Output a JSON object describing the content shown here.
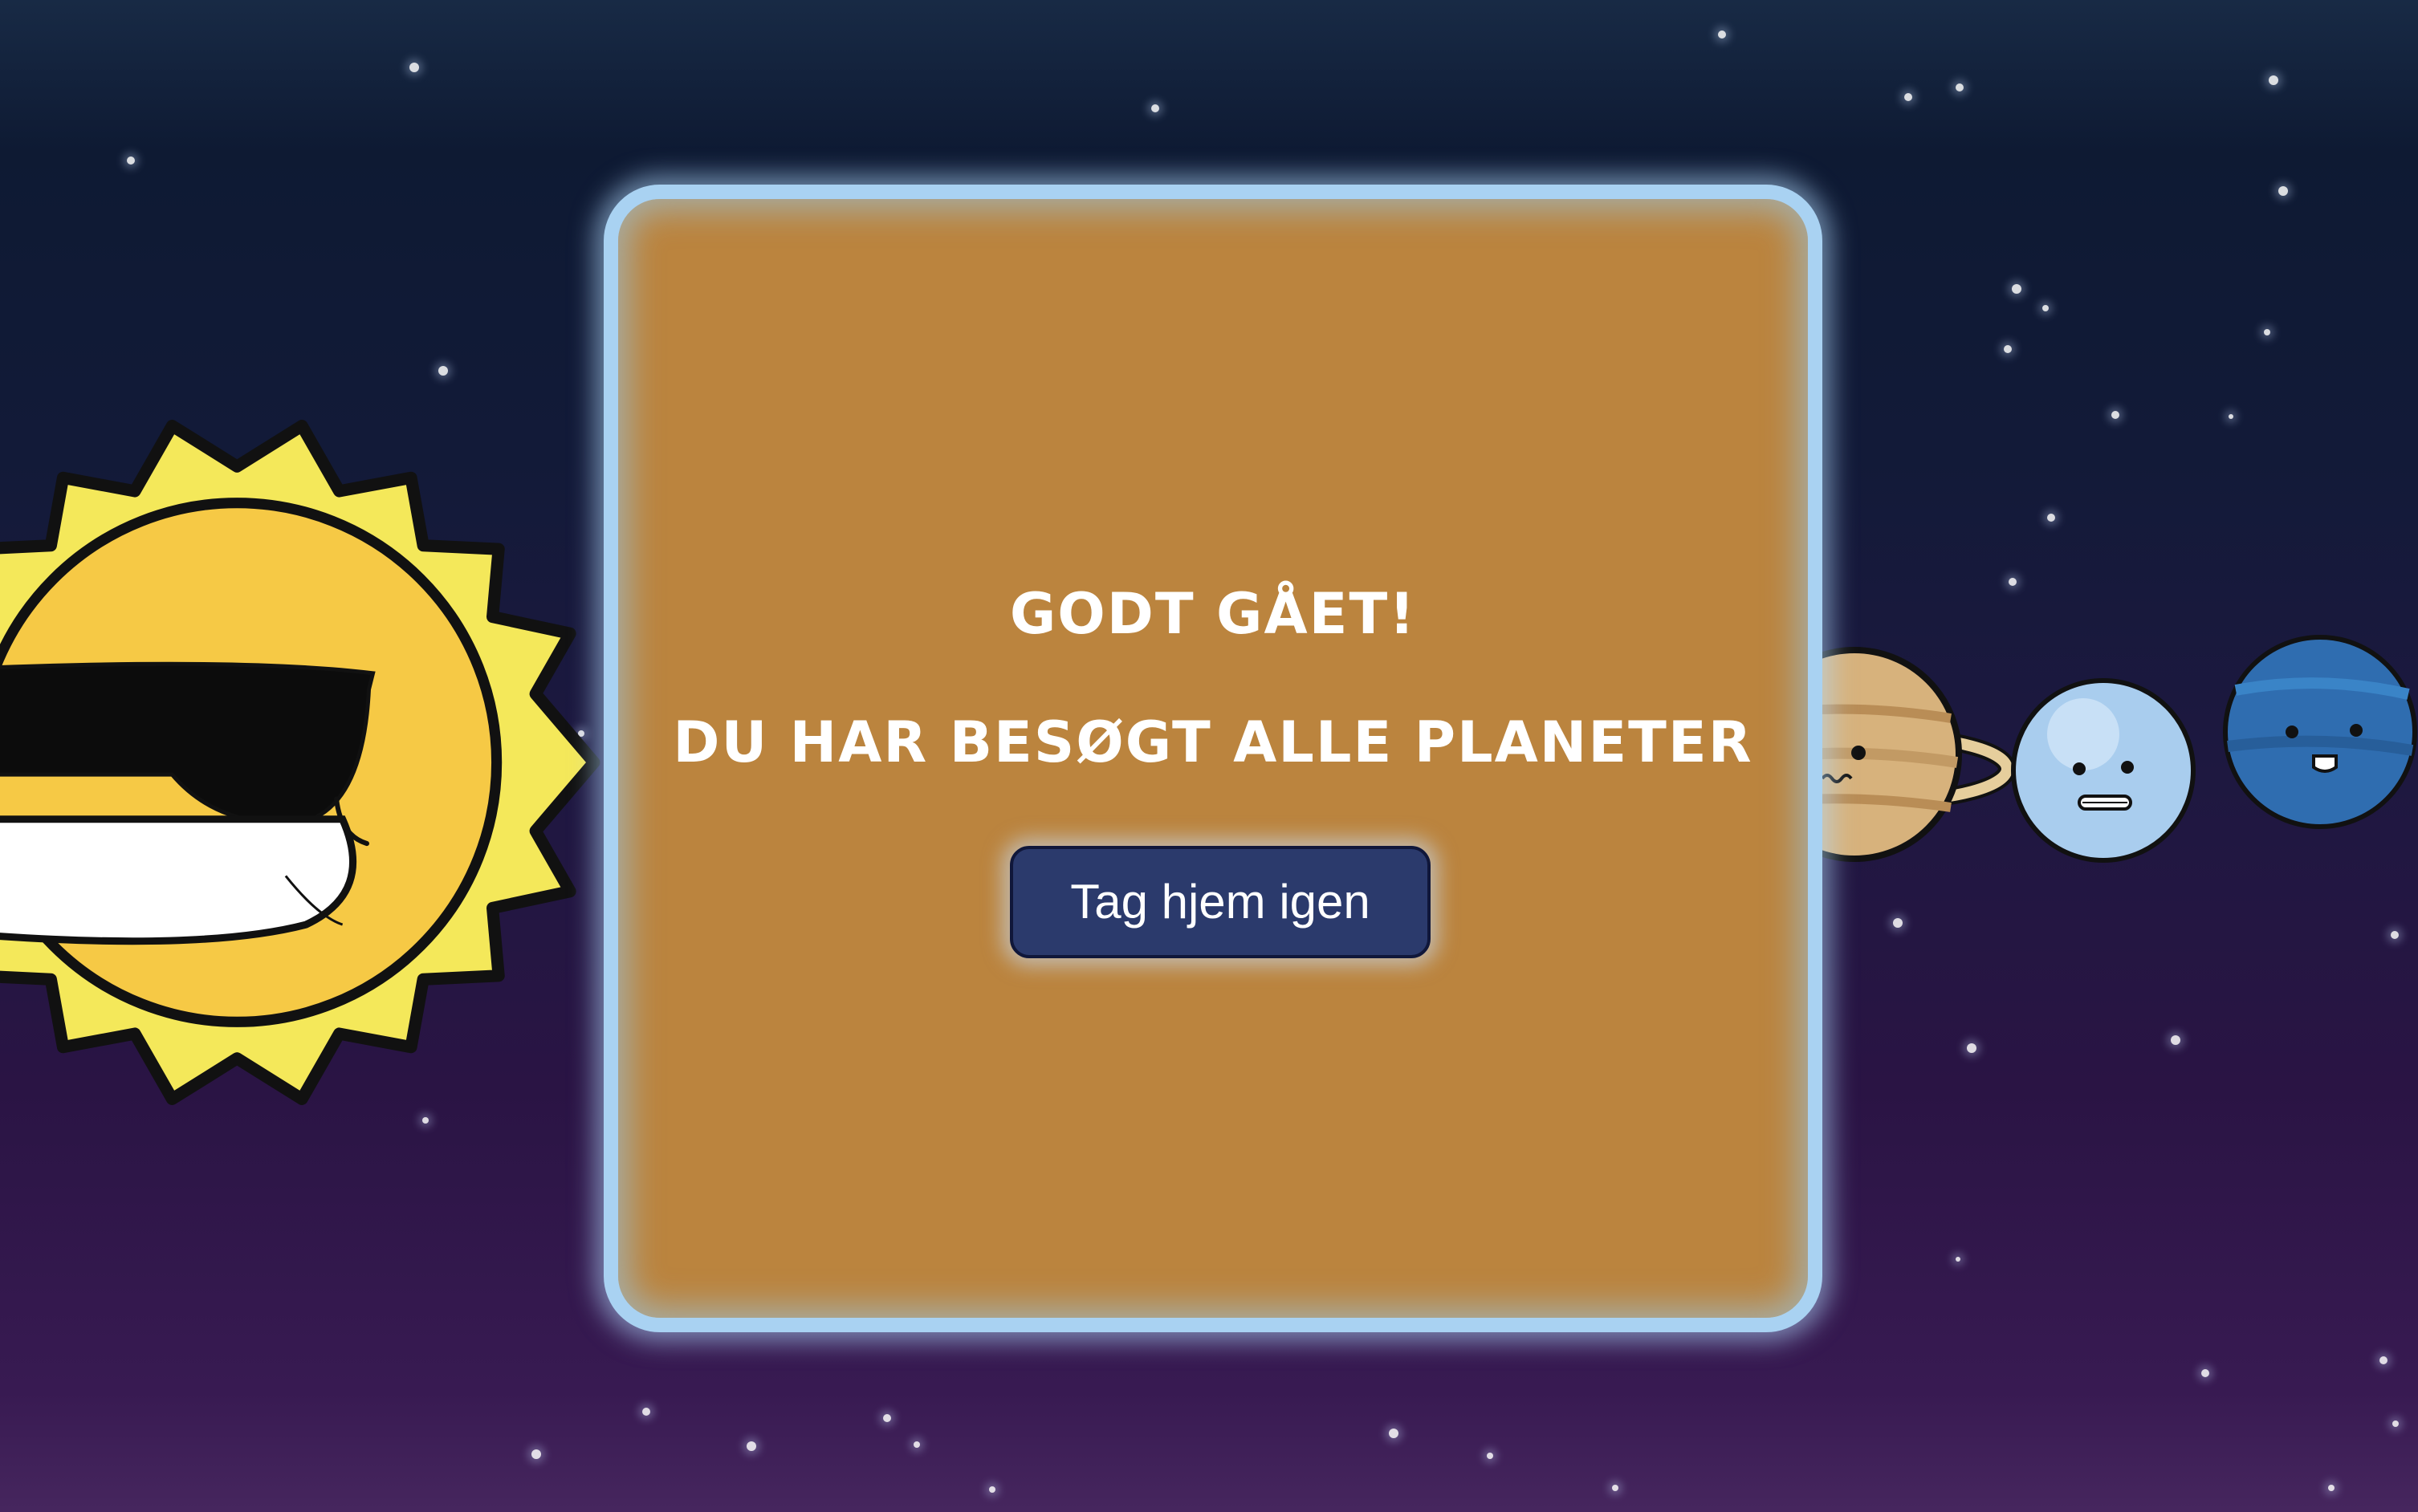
{
  "dialog": {
    "title": "GODT GÅET!",
    "subtitle": "DU HAR BESØGT ALLE PLANETER",
    "button_label": "Tag hjem igen"
  },
  "characters": {
    "sun": "sun-with-sunglasses",
    "planets": [
      "saturn",
      "uranus",
      "neptune"
    ]
  },
  "colors": {
    "panel": "#bb843e",
    "panel_border": "#a9d2f2",
    "button": "#2b3a6c",
    "sun_rays": "#f4e85a",
    "sun_face": "#f6c945"
  }
}
